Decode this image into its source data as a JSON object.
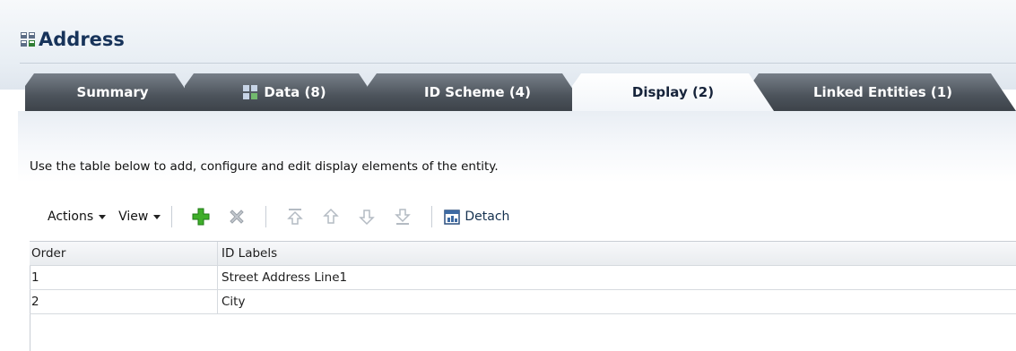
{
  "page": {
    "title": "Address",
    "title_icon": "entity-data-icon"
  },
  "tabs": [
    {
      "label": "Summary",
      "active": false
    },
    {
      "label": "Data (8)",
      "active": false,
      "icon": "entity-data-icon"
    },
    {
      "label": "ID Scheme (4)",
      "active": false
    },
    {
      "label": "Display (2)",
      "active": true
    },
    {
      "label": "Linked Entities (1)",
      "active": false
    }
  ],
  "instructions": "Use the table below to add, configure and edit display elements of the entity.",
  "toolbar": {
    "actions_label": "Actions",
    "view_label": "View",
    "detach_label": "Detach",
    "icons": [
      "add-icon",
      "delete-icon",
      "move-top-icon",
      "move-up-icon",
      "move-down-icon",
      "move-bottom-icon",
      "detach-icon"
    ]
  },
  "table": {
    "columns": [
      "Order",
      "ID Labels"
    ],
    "rows": [
      [
        "1",
        "Street Address Line1"
      ],
      [
        "2",
        "City"
      ]
    ]
  },
  "colors": {
    "accent_title": "#17335a",
    "tab_dark": "#4c535b",
    "add_green": "#3fae2a"
  }
}
